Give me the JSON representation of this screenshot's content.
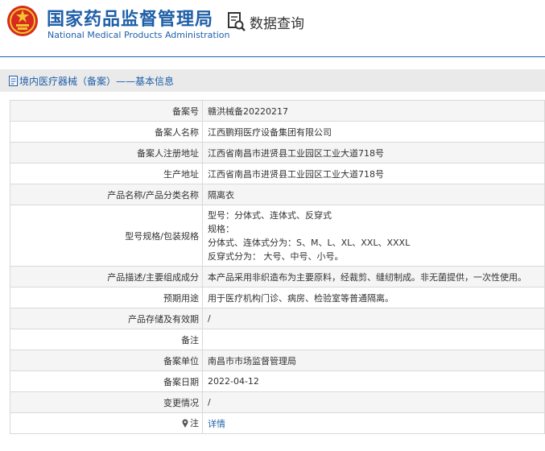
{
  "header": {
    "org_name_cn": "国家药品监督管理局",
    "org_name_en": "National Medical Products Administration",
    "query_label": "数据查询",
    "brand_color": "#1f5fa8"
  },
  "section": {
    "title": "境内医疗器械（备案）——基本信息",
    "icon": "document-icon"
  },
  "record": {
    "filing_no": {
      "label": "备案号",
      "value": "赣洪械备20220217"
    },
    "filer_name": {
      "label": "备案人名称",
      "value": "江西鹏翔医疗设备集团有限公司"
    },
    "filer_address": {
      "label": "备案人注册地址",
      "value": "江西省南昌市进贤县工业园区工业大道718号"
    },
    "production_address": {
      "label": "生产地址",
      "value": "江西省南昌市进贤县工业园区工业大道718号"
    },
    "product_name": {
      "label": "产品名称/产品分类名称",
      "value": "隔离衣"
    },
    "model_spec": {
      "label": "型号规格/包装规格",
      "lines": [
        "型号：分体式、连体式、反穿式",
        "规格：",
        "分体式、连体式分为：S、M、L、XL、XXL、XXXL",
        "反穿式分为： 大号、中号、小号。"
      ]
    },
    "description": {
      "label": "产品描述/主要组成成分",
      "value": "本产品采用非织造布为主要原料，经裁剪、缝纫制成。非无菌提供，一次性使用。"
    },
    "intended_use": {
      "label": "预期用途",
      "value": "用于医疗机构门诊、病房、检验室等普通隔离。"
    },
    "storage": {
      "label": "产品存储及有效期",
      "value": "/"
    },
    "remarks": {
      "label": "备注",
      "value": ""
    },
    "filing_unit": {
      "label": "备案单位",
      "value": "南昌市市场监督管理局"
    },
    "filing_date": {
      "label": "备案日期",
      "value": "2022-04-12"
    },
    "change_info": {
      "label": "变更情况",
      "value": "/"
    },
    "note": {
      "label": "注",
      "link_label": "详情"
    }
  }
}
